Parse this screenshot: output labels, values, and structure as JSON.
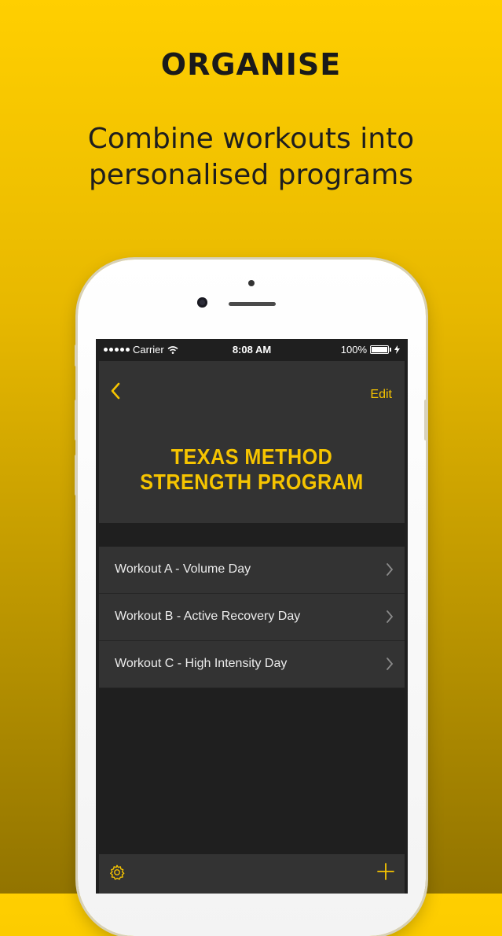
{
  "promo": {
    "headline": "ORGANISE",
    "subline_1": "Combine workouts into",
    "subline_2": "personalised programs"
  },
  "status_bar": {
    "carrier": "Carrier",
    "time": "8:08 AM",
    "battery": "100%"
  },
  "nav": {
    "back_icon": "chevron-left-icon",
    "edit_label": "Edit"
  },
  "program": {
    "title_line_1": "TEXAS METHOD",
    "title_line_2": "STRENGTH PROGRAM"
  },
  "workouts": [
    {
      "label": "Workout A - Volume Day"
    },
    {
      "label": "Workout B - Active Recovery Day"
    },
    {
      "label": "Workout C - High Intensity Day"
    }
  ],
  "toolbar": {
    "settings_icon": "gear-icon",
    "add_icon": "plus-icon"
  },
  "colors": {
    "accent": "#f6c400",
    "background_top": "#ffcf00",
    "background_bottom": "#927400",
    "screen_bg": "#1f1f1f",
    "card_bg": "#333333"
  }
}
